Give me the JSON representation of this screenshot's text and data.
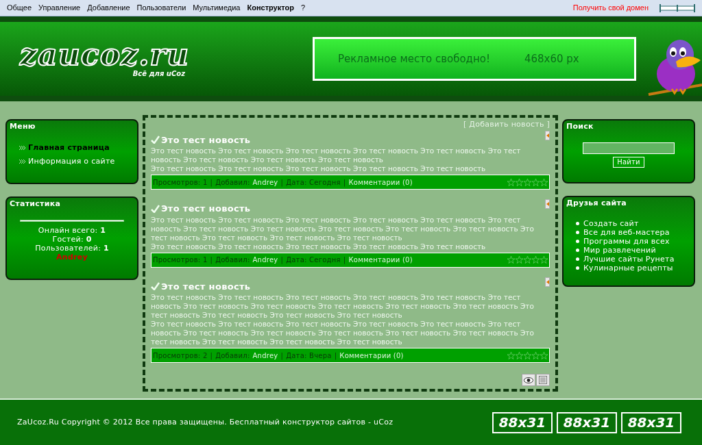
{
  "admin_bar": {
    "items": [
      {
        "label": "Общее",
        "selected": false
      },
      {
        "label": "Управление",
        "selected": false
      },
      {
        "label": "Добавление",
        "selected": false
      },
      {
        "label": "Пользователи",
        "selected": false
      },
      {
        "label": "Мультимедиа",
        "selected": false
      },
      {
        "label": "Конструктор",
        "selected": true
      },
      {
        "label": "?",
        "selected": false
      }
    ],
    "domain_link": "Получить свой домен"
  },
  "header": {
    "logo": "zaucoz.ru",
    "tagline": "Всё для uCoz",
    "banner": {
      "text": "Рекламное место свободно!",
      "size": "468x60 px"
    }
  },
  "left_blocks": [
    {
      "kind": "menu",
      "title": "Меню",
      "items": [
        {
          "label": "Главная страница",
          "selected": true
        },
        {
          "label": "Информация о сайте",
          "selected": false
        }
      ]
    },
    {
      "kind": "stats",
      "title": "Статистика",
      "lines": [
        "Онлайн всего: **1**",
        "Гостей: **0**",
        "Пользователей: **1**"
      ],
      "users": [
        "Andrey"
      ]
    }
  ],
  "content": {
    "add_link": "[ Добавить новость ]",
    "news": [
      {
        "title": "Это тест новость",
        "paragraphs": [
          "Это тест новость Это тест новость Это тест новость Это тест новость Это тест новость Это тест новость Это тест новость Это тест новость Это тест новость",
          "Это тест новость Это тест новость Это тест новость Это тест новость Это тест новость"
        ],
        "meta": [
          {
            "kind": "label",
            "text": "Просмотров: 1"
          },
          {
            "kind": "sep",
            "text": "|"
          },
          {
            "kind": "label",
            "text": "Добавил:"
          },
          {
            "kind": "link",
            "text": "Andrey"
          },
          {
            "kind": "sep",
            "text": "|"
          },
          {
            "kind": "label",
            "text": "Дата: Сегодня"
          },
          {
            "kind": "sep",
            "text": "|"
          },
          {
            "kind": "link",
            "text": "Комментарии (0)"
          }
        ],
        "stars": 0
      },
      {
        "title": "Это тест новость",
        "paragraphs": [
          "Это тест новость Это тест новость Это тест новость Это тест новость Это тест новость Это тест новость Это тест новость Это тест новость Это тест новость Это тест новость Это тест новость Это тест новость Это тест новость Это тест новость Это тест новость",
          "Это тест новость Это тест новость Это тест новость Это тест новость Это тест новость"
        ],
        "meta": [
          {
            "kind": "label",
            "text": "Просмотров: 1"
          },
          {
            "kind": "sep",
            "text": "|"
          },
          {
            "kind": "label",
            "text": "Добавил:"
          },
          {
            "kind": "link",
            "text": "Andrey"
          },
          {
            "kind": "sep",
            "text": "|"
          },
          {
            "kind": "label",
            "text": "Дата: Сегодня"
          },
          {
            "kind": "sep",
            "text": "|"
          },
          {
            "kind": "link",
            "text": "Комментарии (0)"
          }
        ],
        "stars": 0
      },
      {
        "title": "Это тест новость",
        "paragraphs": [
          "Это тест новость Это тест новость Это тест новость Это тест новость Это тест новость Это тест новость Это тест новость Это тест новость Это тест новость Это тест новость Это тест новость Это тест новость Это тест новость Это тест новость Это тест новость",
          "Это тест новость Это тест новость Это тест новость Это тест новость Это тест новость Это тест новость Это тест новость Это тест новость Это тест новость Это тест новость Это тест новость Это тест новость Это тест новость Это тест новость Это тест новость"
        ],
        "meta": [
          {
            "kind": "label",
            "text": "Просмотров: 2"
          },
          {
            "kind": "sep",
            "text": "|"
          },
          {
            "kind": "label",
            "text": "Добавил:"
          },
          {
            "kind": "link",
            "text": "Andrey"
          },
          {
            "kind": "sep",
            "text": "|"
          },
          {
            "kind": "label",
            "text": "Дата: Вчера"
          },
          {
            "kind": "sep",
            "text": "|"
          },
          {
            "kind": "link",
            "text": "Комментарии (0)"
          }
        ],
        "stars": 0
      }
    ]
  },
  "right_blocks": [
    {
      "kind": "search",
      "title": "Поиск",
      "button": "Найти"
    },
    {
      "kind": "links",
      "title": "Друзья сайта",
      "items": [
        "Создать сайт",
        "Все для веб-мастера",
        "Программы для всех",
        "Мир развлечений",
        "Лучшие сайты Рунета",
        "Кулинарные рецепты"
      ]
    }
  ],
  "footer": {
    "copyright": "ZaUcoz.Ru Copyright © 2012 Все права защищены. Бесплатный конструктор сайтов - uCoz",
    "badges": [
      "88x31",
      "88x31",
      "88x31"
    ]
  }
}
